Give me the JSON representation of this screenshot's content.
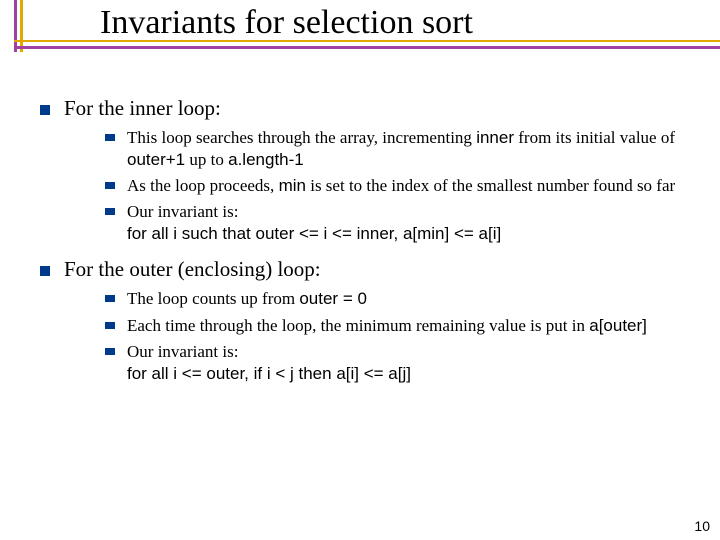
{
  "title": "Invariants for selection sort",
  "page_number": "10",
  "sections": [
    {
      "heading": "For the inner loop:",
      "items": [
        {
          "plain_before": "This loop searches through the array, incrementing ",
          "code1": "inner",
          "plain_mid1": " from its initial value of ",
          "code2": "outer+1",
          "plain_mid2": " up to ",
          "code3": "a.length-1",
          "plain_after": ""
        },
        {
          "plain_before": "As the loop proceeds, ",
          "code1": "min",
          "plain_mid1": " is set to the index of the smallest number found so far",
          "code2": "",
          "plain_mid2": "",
          "code3": "",
          "plain_after": ""
        },
        {
          "plain_before": "Our invariant is:",
          "code_line": "for all i such that outer <= i <= inner, a[min] <= a[i]"
        }
      ]
    },
    {
      "heading": "For the outer (enclosing) loop:",
      "items": [
        {
          "plain_before": "The loop counts up from ",
          "code1": "outer = 0",
          "plain_mid1": "",
          "code2": "",
          "plain_mid2": "",
          "code3": "",
          "plain_after": ""
        },
        {
          "plain_before": "Each time through the loop, the minimum remaining value is put in ",
          "code1": "a[outer]",
          "plain_mid1": "",
          "code2": "",
          "plain_mid2": "",
          "code3": "",
          "plain_after": ""
        },
        {
          "plain_before": "Our invariant is:",
          "code_line": "for all i <= outer, if i < j then a[i] <= a[j]"
        }
      ]
    }
  ]
}
